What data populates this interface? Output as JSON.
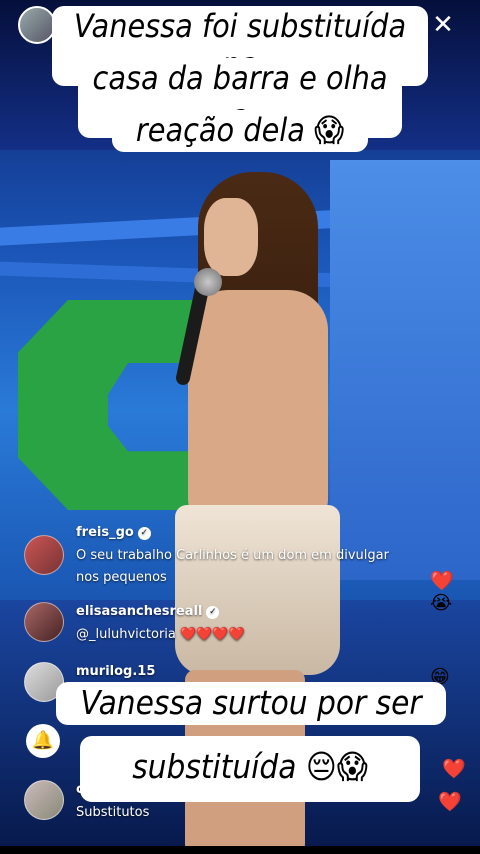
{
  "captions": {
    "top_line1": "Vanessa foi substituída na",
    "top_line2": "casa da barra e olha a",
    "top_line3": "reação dela",
    "bottom_line1": "Vanessa surtou por ser",
    "bottom_line2": "substituída"
  },
  "emojis": {
    "scream": "😱",
    "pensive": "😔",
    "heart": "❤️",
    "cry": "😭",
    "grin": "😁"
  },
  "close_label": "✕",
  "comments": [
    {
      "username": "freis_go",
      "verified": true,
      "text": "O seu trabalho Carlinhos é um dom em divulgar nos pequenos"
    },
    {
      "username": "elisasanchesreall",
      "verified": true,
      "text": "@_luluhvictoria",
      "hearts": "❤️❤️❤️❤️"
    },
    {
      "username": "murilog.15",
      "verified": false,
      "text": ""
    },
    {
      "username": "c",
      "verified": false,
      "text": "Substitutos"
    }
  ],
  "colors": {
    "caption_bg": "#ffffff",
    "heart": "#f03a3a"
  }
}
